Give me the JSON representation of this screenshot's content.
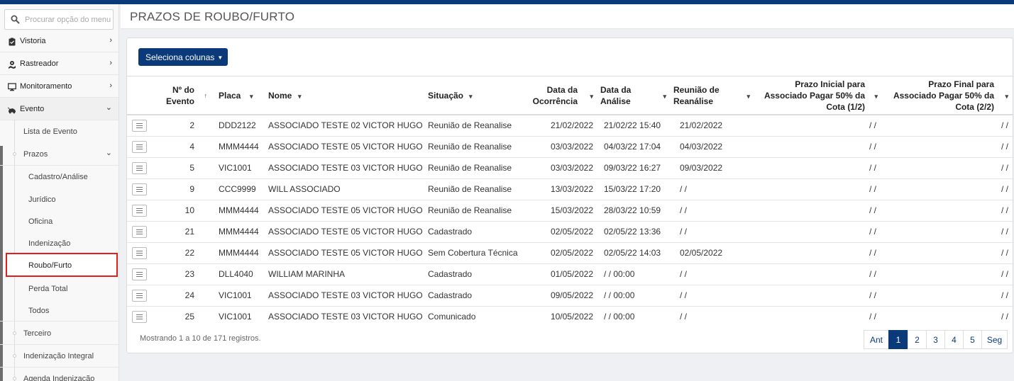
{
  "sidebar": {
    "search_placeholder": "Procurar opção do menu",
    "menu": {
      "vistoria": "Vistoria",
      "rastreador": "Rastreador",
      "monitoramento": "Monitoramento",
      "evento": "Evento"
    },
    "evento_sub": {
      "lista": "Lista de Evento",
      "prazos": "Prazos",
      "terceiro": "Terceiro",
      "indenizacao_integral": "Indenização Integral",
      "agenda": "Agenda Indenização"
    },
    "prazos_sub": [
      "Cadastro/Análise",
      "Jurídico",
      "Oficina",
      "Indenização",
      "Roubo/Furto",
      "Perda Total",
      "Todos"
    ],
    "active_item": "Roubo/Furto"
  },
  "page": {
    "title": "PRAZOS DE ROUBO/FURTO",
    "columns_button": "Seleciona colunas"
  },
  "table": {
    "headers": {
      "evento": [
        "Nº do",
        "Evento"
      ],
      "placa": "Placa",
      "nome": "Nome",
      "situacao": "Situação",
      "data_ocorrencia": [
        "Data da",
        "Ocorrência"
      ],
      "data_analise": [
        "Data da",
        "Análise"
      ],
      "reuniao": [
        "Reunião de",
        "Reanálise"
      ],
      "prazo_inicial": [
        "Prazo Inicial para",
        "Associado Pagar 50% da",
        "Cota (1/2)"
      ],
      "prazo_final": [
        "Prazo Final para",
        "Associado Pagar 50% da",
        "Cota (2/2)"
      ]
    },
    "rows": [
      {
        "evento": "2",
        "placa": "DDD2122",
        "nome": "ASSOCIADO TESTE 02 VICTOR HUGO",
        "situacao": "Reunião de Reanalise",
        "ocorrencia": "21/02/2022",
        "analise": "21/02/22 15:40",
        "reuniao": "21/02/2022",
        "prazo1": "/ /",
        "prazo2": "/ /"
      },
      {
        "evento": "4",
        "placa": "MMM4444",
        "nome": "ASSOCIADO TESTE 05 VICTOR HUGO",
        "situacao": "Reunião de Reanalise",
        "ocorrencia": "03/03/2022",
        "analise": "04/03/22 17:04",
        "reuniao": "04/03/2022",
        "prazo1": "/ /",
        "prazo2": "/ /"
      },
      {
        "evento": "5",
        "placa": "VIC1001",
        "nome": "ASSOCIADO TESTE 03 VICTOR HUGO",
        "situacao": "Reunião de Reanalise",
        "ocorrencia": "03/03/2022",
        "analise": "09/03/22 16:27",
        "reuniao": "09/03/2022",
        "prazo1": "/ /",
        "prazo2": "/ /"
      },
      {
        "evento": "9",
        "placa": "CCC9999",
        "nome": "WILL ASSOCIADO",
        "situacao": "Reunião de Reanalise",
        "ocorrencia": "13/03/2022",
        "analise": "15/03/22 17:20",
        "reuniao": "/ /",
        "prazo1": "/ /",
        "prazo2": "/ /"
      },
      {
        "evento": "10",
        "placa": "MMM4444",
        "nome": "ASSOCIADO TESTE 05 VICTOR HUGO",
        "situacao": "Reunião de Reanalise",
        "ocorrencia": "15/03/2022",
        "analise": "28/03/22 10:59",
        "reuniao": "/ /",
        "prazo1": "/ /",
        "prazo2": "/ /"
      },
      {
        "evento": "21",
        "placa": "MMM4444",
        "nome": "ASSOCIADO TESTE 05 VICTOR HUGO",
        "situacao": "Cadastrado",
        "ocorrencia": "02/05/2022",
        "analise": "02/05/22 13:36",
        "reuniao": "/ /",
        "prazo1": "/ /",
        "prazo2": "/ /"
      },
      {
        "evento": "22",
        "placa": "MMM4444",
        "nome": "ASSOCIADO TESTE 05 VICTOR HUGO",
        "situacao": "Sem Cobertura Técnica",
        "ocorrencia": "02/05/2022",
        "analise": "02/05/22 14:03",
        "reuniao": "02/05/2022",
        "prazo1": "/ /",
        "prazo2": "/ /"
      },
      {
        "evento": "23",
        "placa": "DLL4040",
        "nome": "WILLIAM MARINHA",
        "situacao": "Cadastrado",
        "ocorrencia": "01/05/2022",
        "analise": "/ / 00:00",
        "reuniao": "/ /",
        "prazo1": "/ /",
        "prazo2": "/ /"
      },
      {
        "evento": "24",
        "placa": "VIC1001",
        "nome": "ASSOCIADO TESTE 03 VICTOR HUGO",
        "situacao": "Cadastrado",
        "ocorrencia": "09/05/2022",
        "analise": "/ / 00:00",
        "reuniao": "/ /",
        "prazo1": "/ /",
        "prazo2": "/ /"
      },
      {
        "evento": "25",
        "placa": "VIC1001",
        "nome": "ASSOCIADO TESTE 03 VICTOR HUGO",
        "situacao": "Comunicado",
        "ocorrencia": "10/05/2022",
        "analise": "/ / 00:00",
        "reuniao": "/ /",
        "prazo1": "/ /",
        "prazo2": "/ /"
      }
    ]
  },
  "footer": {
    "info": "Mostrando 1 a 10 de 171 registros.",
    "pager": [
      "Ant",
      "1",
      "2",
      "3",
      "4",
      "5",
      "Seg"
    ],
    "current_page": "1"
  },
  "colors": {
    "brand": "#0b3a7a",
    "highlight_border": "#e02020"
  }
}
